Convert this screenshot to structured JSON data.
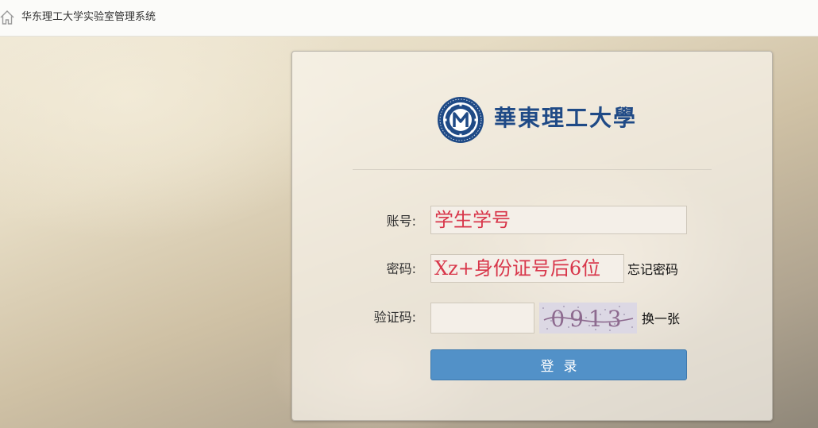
{
  "app": {
    "title": "华东理工大学实验室管理系统",
    "home_icon": "home-icon"
  },
  "logo": {
    "text": "華東理工大學",
    "seal_text": "EAST CHINA UNIVERSITY OF SCIENCE AND TECHNOLOGY"
  },
  "form": {
    "account_label": "账号:",
    "account_placeholder": "学生学号",
    "password_label": "密码:",
    "password_placeholder": "Xz+身份证号后6位",
    "forgot_password": "忘记密码",
    "captcha_label": "验证码:",
    "captcha_value": "",
    "captcha_text": "0913",
    "refresh_captcha": "换一张",
    "login_button": "登录"
  },
  "colors": {
    "accent": "#5291c8",
    "hint_text": "#d8364a",
    "logo_blue": "#1f4a86"
  }
}
